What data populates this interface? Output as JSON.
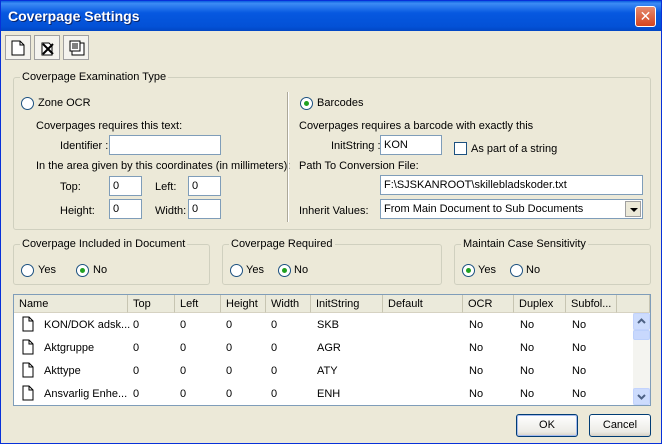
{
  "window": {
    "title": "Coverpage Settings"
  },
  "toolbar": {
    "icons": [
      "new-icon",
      "delete-icon",
      "properties-icon"
    ]
  },
  "exam": {
    "legend": "Coverpage Examination Type",
    "zone": {
      "label": "Zone OCR",
      "requires_text": "Coverpages requires this text:",
      "identifier_label": "Identifier :",
      "identifier_value": "",
      "coords_text": "In the area given by this coordinates (in millimeters):",
      "top_label": "Top:",
      "top_value": "0",
      "left_label": "Left:",
      "left_value": "0",
      "height_label": "Height:",
      "height_value": "0",
      "width_label": "Width:",
      "width_value": "0"
    },
    "barcodes": {
      "label": "Barcodes",
      "requires_text": "Coverpages requires a barcode with exactly this",
      "initstring_label": "InitString :",
      "initstring_value": "KON",
      "part_label": "As part of a string",
      "path_label": "Path To Conversion File:",
      "path_value": "F:\\SJSKANROOT\\skillebladskoder.txt",
      "inherit_label": "Inherit Values:",
      "inherit_value": "From Main Document to Sub Documents"
    }
  },
  "included": {
    "legend": "Coverpage Included in Document",
    "yes": "Yes",
    "no": "No"
  },
  "required": {
    "legend": "Coverpage Required",
    "yes": "Yes",
    "no": "No"
  },
  "casesens": {
    "legend": "Maintain Case Sensitivity",
    "yes": "Yes",
    "no": "No"
  },
  "table": {
    "columns": [
      "Name",
      "Top",
      "Left",
      "Height",
      "Width",
      "InitString",
      "Default",
      "OCR",
      "Duplex",
      "Subfol..."
    ],
    "rows": [
      [
        "KON/DOK adsk...",
        "0",
        "0",
        "0",
        "0",
        "SKB",
        "",
        "No",
        "No",
        "No"
      ],
      [
        "Aktgruppe",
        "0",
        "0",
        "0",
        "0",
        "AGR",
        "",
        "No",
        "No",
        "No"
      ],
      [
        "Akttype",
        "0",
        "0",
        "0",
        "0",
        "ATY",
        "",
        "No",
        "No",
        "No"
      ],
      [
        "Ansvarlig Enhe...",
        "0",
        "0",
        "0",
        "0",
        "ENH",
        "",
        "No",
        "No",
        "No"
      ]
    ]
  },
  "buttons": {
    "ok": "OK",
    "cancel": "Cancel"
  },
  "colors": {
    "titlebar": "#0658e0",
    "face": "#ece9d8",
    "radio_dot": "#21a121"
  }
}
